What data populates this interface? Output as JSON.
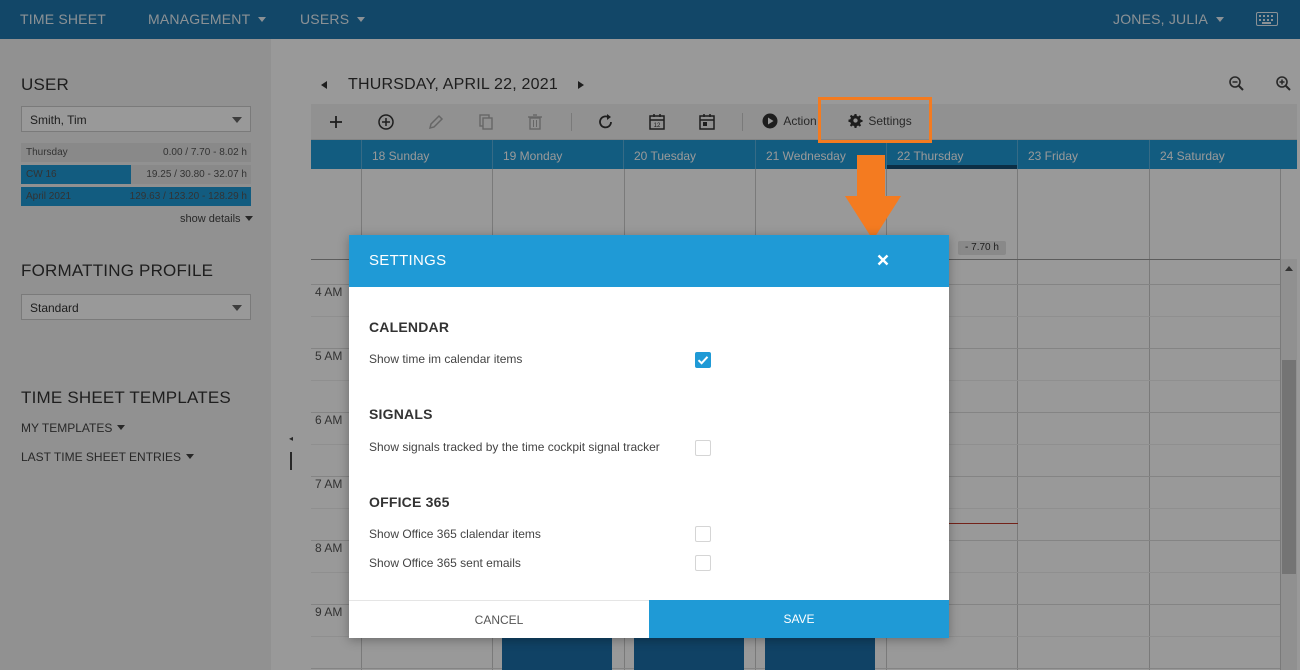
{
  "topnav": {
    "items": [
      "TIME SHEET",
      "MANAGEMENT",
      "USERS"
    ],
    "user": "JONES, JULIA",
    "keyboard_icon": "keyboard-icon"
  },
  "sidebar": {
    "user_heading": "USER",
    "user_select": "Smith, Tim",
    "stats": [
      {
        "label": "Thursday",
        "value": "0.00 / 7.70 - 8.02 h",
        "progress": 0.0,
        "color": "#8a8a8a"
      },
      {
        "label": "CW 16",
        "value": "19.25 / 30.80 - 32.07 h",
        "progress": 0.48,
        "color": "#1f9ad6"
      },
      {
        "label": "April 2021",
        "value": "129.63 / 123.20 - 128.29 h",
        "progress": 1.0,
        "color": "#1f9ad6"
      }
    ],
    "show_details": "show details",
    "profile_heading": "FORMATTING PROFILE",
    "profile_select": "Standard",
    "templates_heading": "TIME SHEET TEMPLATES",
    "my_templates": "MY TEMPLATES",
    "last_entries": "LAST TIME SHEET ENTRIES"
  },
  "calendar": {
    "date_title": "THURSDAY, APRIL 22, 2021",
    "toolbar": {
      "action_label": "Action",
      "settings_label": "Settings",
      "date_icon_number": "12"
    },
    "days": [
      "18 Sunday",
      "19 Monday",
      "20 Tuesday",
      "21 Wednesday",
      "22 Thursday",
      "23 Friday",
      "24 Saturday"
    ],
    "times": [
      "4 AM",
      "5 AM",
      "6 AM",
      "7 AM",
      "8 AM",
      "9 AM"
    ],
    "day_badge": "- 7.70 h"
  },
  "dialog": {
    "title": "SETTINGS",
    "sections": [
      {
        "title": "CALENDAR",
        "options": [
          {
            "label": "Show time im calendar items",
            "checked": true
          }
        ]
      },
      {
        "title": "SIGNALS",
        "options": [
          {
            "label": "Show signals tracked by the time cockpit signal tracker",
            "checked": false
          }
        ]
      },
      {
        "title": "OFFICE 365",
        "options": [
          {
            "label": "Show Office 365 clalendar items",
            "checked": false
          },
          {
            "label": "Show Office 365 sent emails",
            "checked": false
          }
        ]
      }
    ],
    "cancel_label": "CANCEL",
    "save_label": "SAVE"
  },
  "colors": {
    "nav": "#1f77ad",
    "accent": "#1f9ad6",
    "annotation": "#f47b20"
  }
}
